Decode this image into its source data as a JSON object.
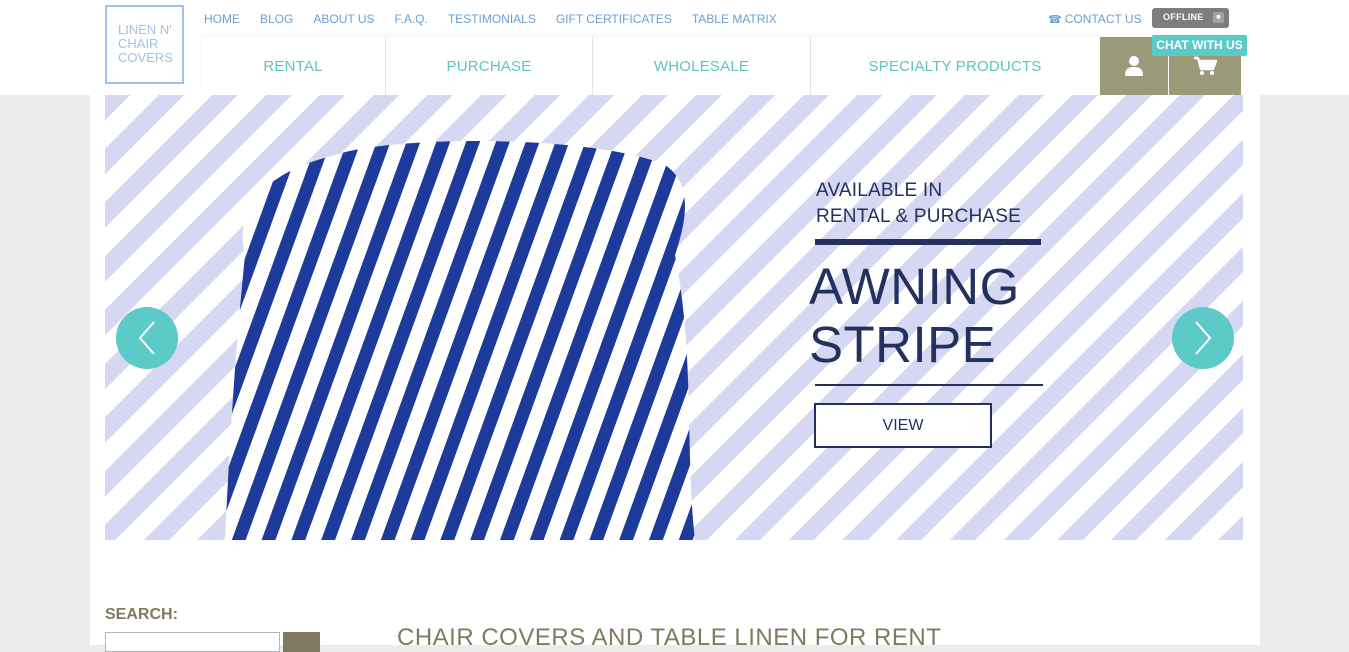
{
  "logo": {
    "lines": [
      "LINEN N'",
      "CHAIR",
      "COVERS"
    ]
  },
  "topnav": [
    "HOME",
    "BLOG",
    "ABOUT US",
    "F.A.Q.",
    "TESTIMONIALS",
    "GIFT CERTIFICATES",
    "TABLE MATRIX"
  ],
  "contact": {
    "icon": "phone-icon",
    "label": "CONTACT US"
  },
  "chat": {
    "status": "OFFLINE",
    "label": "CHAT WITH US"
  },
  "mainnav": [
    "RENTAL",
    "PURCHASE",
    "WHOLESALE",
    "SPECIALTY PRODUCTS"
  ],
  "icons": {
    "user": "user-icon",
    "cart": "cart-icon"
  },
  "hero": {
    "availability_line1": "AVAILABLE IN",
    "availability_line2": "RENTAL & PURCHASE",
    "headline_line1": "AWNING",
    "headline_line2": "STRIPE",
    "button": "VIEW"
  },
  "search": {
    "label": "SEARCH:",
    "placeholder": ""
  },
  "section_title": "CHAIR COVERS AND TABLE LINEN FOR RENT",
  "colors": {
    "accent": "#5ccac6",
    "navy": "#24305e",
    "olive": "#7f7a60",
    "link": "#6a9fd4"
  }
}
